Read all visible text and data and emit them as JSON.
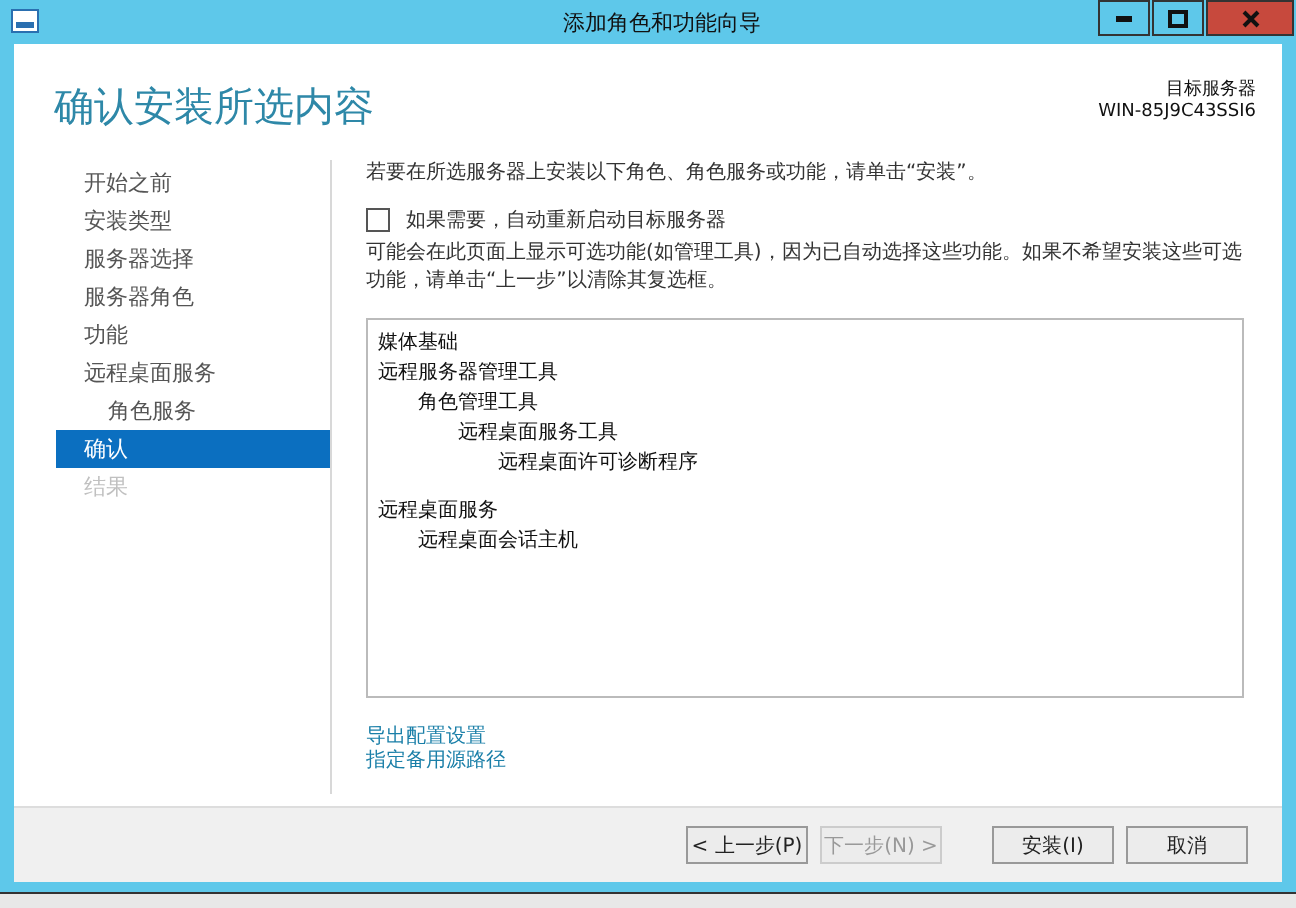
{
  "window": {
    "title": "添加角色和功能向导"
  },
  "header": {
    "title": "确认安装所选内容",
    "server_label": "目标服务器",
    "server_name": "WIN-85J9C43SSI6"
  },
  "sidebar": {
    "items": [
      {
        "label": "开始之前",
        "selected": false,
        "disabled": false
      },
      {
        "label": "安装类型",
        "selected": false,
        "disabled": false
      },
      {
        "label": "服务器选择",
        "selected": false,
        "disabled": false
      },
      {
        "label": "服务器角色",
        "selected": false,
        "disabled": false
      },
      {
        "label": "功能",
        "selected": false,
        "disabled": false
      },
      {
        "label": "远程桌面服务",
        "selected": false,
        "disabled": false,
        "children": [
          {
            "label": "角色服务",
            "selected": false,
            "disabled": false
          }
        ]
      },
      {
        "label": "确认",
        "selected": true,
        "disabled": false
      },
      {
        "label": "结果",
        "selected": false,
        "disabled": true
      }
    ]
  },
  "intro": "若要在所选服务器上安装以下角色、角色服务或功能，请单击“安装”。",
  "restart_option": {
    "label": "如果需要，自动重新启动目标服务器",
    "checked": false
  },
  "note": "可能会在此页面上显示可选功能(如管理工具)，因为已自动选择这些功能。如果不希望安装这些可选功能，请单击“上一步”以清除其复选框。",
  "selection_list": [
    {
      "label": "媒体基础"
    },
    {
      "label": "远程服务器管理工具",
      "children": [
        {
          "label": "角色管理工具",
          "children": [
            {
              "label": "远程桌面服务工具",
              "children": [
                {
                  "label": "远程桌面许可诊断程序"
                }
              ]
            }
          ]
        }
      ]
    },
    {
      "label": "远程桌面服务",
      "children": [
        {
          "label": "远程桌面会话主机"
        }
      ]
    }
  ],
  "links": [
    "导出配置设置",
    "指定备用源路径"
  ],
  "buttons": [
    {
      "label": "< 上一步(P)",
      "disabled": false
    },
    {
      "label": "下一步(N) >",
      "disabled": true
    },
    {
      "label": "安装(I)",
      "disabled": false
    },
    {
      "label": "取消",
      "disabled": false
    }
  ]
}
